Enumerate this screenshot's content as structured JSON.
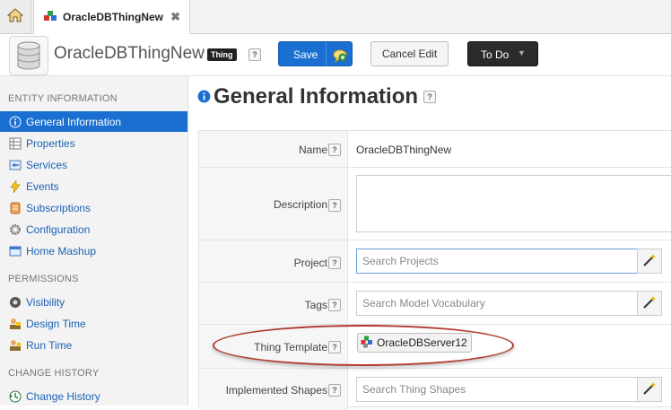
{
  "tabs": {
    "home_icon": "home-icon",
    "active_tab_label": "OracleDBThingNew",
    "close_glyph": "✖"
  },
  "header": {
    "entity_name": "OracleDBThingNew",
    "badge": "Thing",
    "help": "?",
    "save_label": "Save",
    "cancel_label": "Cancel Edit",
    "todo_label": "To Do",
    "caret": "▼"
  },
  "sidebar": {
    "sections": [
      {
        "heading": "ENTITY INFORMATION",
        "items": [
          {
            "label": "General Information",
            "icon": "info-icon"
          },
          {
            "label": "Properties",
            "icon": "properties-icon"
          },
          {
            "label": "Services",
            "icon": "services-icon"
          },
          {
            "label": "Events",
            "icon": "events-icon"
          },
          {
            "label": "Subscriptions",
            "icon": "subscriptions-icon"
          },
          {
            "label": "Configuration",
            "icon": "configuration-icon"
          },
          {
            "label": "Home Mashup",
            "icon": "mashup-icon"
          }
        ]
      },
      {
        "heading": "PERMISSIONS",
        "items": [
          {
            "label": "Visibility",
            "icon": "visibility-icon"
          },
          {
            "label": "Design Time",
            "icon": "design-time-icon"
          },
          {
            "label": "Run Time",
            "icon": "run-time-icon"
          }
        ]
      },
      {
        "heading": "CHANGE HISTORY",
        "items": [
          {
            "label": "Change History",
            "icon": "change-history-icon"
          }
        ]
      }
    ]
  },
  "main": {
    "title": "General Information",
    "help": "?",
    "fields": {
      "name": {
        "label": "Name",
        "value": "OracleDBThingNew"
      },
      "description": {
        "label": "Description",
        "value": ""
      },
      "project": {
        "label": "Project",
        "placeholder": "Search Projects"
      },
      "tags": {
        "label": "Tags",
        "placeholder": "Search Model Vocabulary"
      },
      "thing_template": {
        "label": "Thing Template",
        "value": "OracleDBServer12"
      },
      "implemented_shapes": {
        "label": "Implemented Shapes",
        "placeholder": "Search Thing Shapes"
      }
    }
  },
  "colors": {
    "accent": "#1a6fd0",
    "highlight": "#b03a2e",
    "dark_button": "#2b2b2b"
  }
}
